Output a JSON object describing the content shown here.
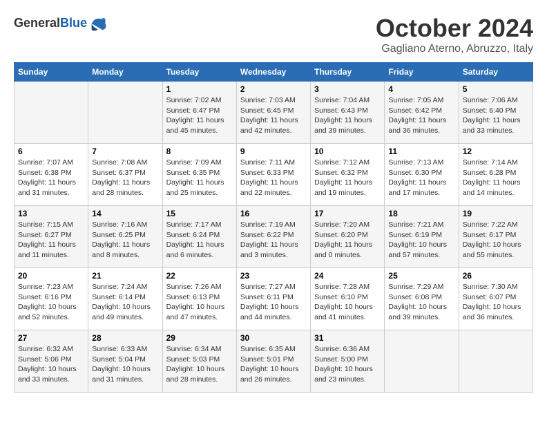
{
  "header": {
    "logo_general": "General",
    "logo_blue": "Blue",
    "month_title": "October 2024",
    "location": "Gagliano Aterno, Abruzzo, Italy"
  },
  "days_of_week": [
    "Sunday",
    "Monday",
    "Tuesday",
    "Wednesday",
    "Thursday",
    "Friday",
    "Saturday"
  ],
  "weeks": [
    [
      {
        "day": "",
        "info": ""
      },
      {
        "day": "",
        "info": ""
      },
      {
        "day": "1",
        "info": "Sunrise: 7:02 AM\nSunset: 6:47 PM\nDaylight: 11 hours and 45 minutes."
      },
      {
        "day": "2",
        "info": "Sunrise: 7:03 AM\nSunset: 6:45 PM\nDaylight: 11 hours and 42 minutes."
      },
      {
        "day": "3",
        "info": "Sunrise: 7:04 AM\nSunset: 6:43 PM\nDaylight: 11 hours and 39 minutes."
      },
      {
        "day": "4",
        "info": "Sunrise: 7:05 AM\nSunset: 6:42 PM\nDaylight: 11 hours and 36 minutes."
      },
      {
        "day": "5",
        "info": "Sunrise: 7:06 AM\nSunset: 6:40 PM\nDaylight: 11 hours and 33 minutes."
      }
    ],
    [
      {
        "day": "6",
        "info": "Sunrise: 7:07 AM\nSunset: 6:38 PM\nDaylight: 11 hours and 31 minutes."
      },
      {
        "day": "7",
        "info": "Sunrise: 7:08 AM\nSunset: 6:37 PM\nDaylight: 11 hours and 28 minutes."
      },
      {
        "day": "8",
        "info": "Sunrise: 7:09 AM\nSunset: 6:35 PM\nDaylight: 11 hours and 25 minutes."
      },
      {
        "day": "9",
        "info": "Sunrise: 7:11 AM\nSunset: 6:33 PM\nDaylight: 11 hours and 22 minutes."
      },
      {
        "day": "10",
        "info": "Sunrise: 7:12 AM\nSunset: 6:32 PM\nDaylight: 11 hours and 19 minutes."
      },
      {
        "day": "11",
        "info": "Sunrise: 7:13 AM\nSunset: 6:30 PM\nDaylight: 11 hours and 17 minutes."
      },
      {
        "day": "12",
        "info": "Sunrise: 7:14 AM\nSunset: 6:28 PM\nDaylight: 11 hours and 14 minutes."
      }
    ],
    [
      {
        "day": "13",
        "info": "Sunrise: 7:15 AM\nSunset: 6:27 PM\nDaylight: 11 hours and 11 minutes."
      },
      {
        "day": "14",
        "info": "Sunrise: 7:16 AM\nSunset: 6:25 PM\nDaylight: 11 hours and 8 minutes."
      },
      {
        "day": "15",
        "info": "Sunrise: 7:17 AM\nSunset: 6:24 PM\nDaylight: 11 hours and 6 minutes."
      },
      {
        "day": "16",
        "info": "Sunrise: 7:19 AM\nSunset: 6:22 PM\nDaylight: 11 hours and 3 minutes."
      },
      {
        "day": "17",
        "info": "Sunrise: 7:20 AM\nSunset: 6:20 PM\nDaylight: 11 hours and 0 minutes."
      },
      {
        "day": "18",
        "info": "Sunrise: 7:21 AM\nSunset: 6:19 PM\nDaylight: 10 hours and 57 minutes."
      },
      {
        "day": "19",
        "info": "Sunrise: 7:22 AM\nSunset: 6:17 PM\nDaylight: 10 hours and 55 minutes."
      }
    ],
    [
      {
        "day": "20",
        "info": "Sunrise: 7:23 AM\nSunset: 6:16 PM\nDaylight: 10 hours and 52 minutes."
      },
      {
        "day": "21",
        "info": "Sunrise: 7:24 AM\nSunset: 6:14 PM\nDaylight: 10 hours and 49 minutes."
      },
      {
        "day": "22",
        "info": "Sunrise: 7:26 AM\nSunset: 6:13 PM\nDaylight: 10 hours and 47 minutes."
      },
      {
        "day": "23",
        "info": "Sunrise: 7:27 AM\nSunset: 6:11 PM\nDaylight: 10 hours and 44 minutes."
      },
      {
        "day": "24",
        "info": "Sunrise: 7:28 AM\nSunset: 6:10 PM\nDaylight: 10 hours and 41 minutes."
      },
      {
        "day": "25",
        "info": "Sunrise: 7:29 AM\nSunset: 6:08 PM\nDaylight: 10 hours and 39 minutes."
      },
      {
        "day": "26",
        "info": "Sunrise: 7:30 AM\nSunset: 6:07 PM\nDaylight: 10 hours and 36 minutes."
      }
    ],
    [
      {
        "day": "27",
        "info": "Sunrise: 6:32 AM\nSunset: 5:06 PM\nDaylight: 10 hours and 33 minutes."
      },
      {
        "day": "28",
        "info": "Sunrise: 6:33 AM\nSunset: 5:04 PM\nDaylight: 10 hours and 31 minutes."
      },
      {
        "day": "29",
        "info": "Sunrise: 6:34 AM\nSunset: 5:03 PM\nDaylight: 10 hours and 28 minutes."
      },
      {
        "day": "30",
        "info": "Sunrise: 6:35 AM\nSunset: 5:01 PM\nDaylight: 10 hours and 26 minutes."
      },
      {
        "day": "31",
        "info": "Sunrise: 6:36 AM\nSunset: 5:00 PM\nDaylight: 10 hours and 23 minutes."
      },
      {
        "day": "",
        "info": ""
      },
      {
        "day": "",
        "info": ""
      }
    ]
  ]
}
